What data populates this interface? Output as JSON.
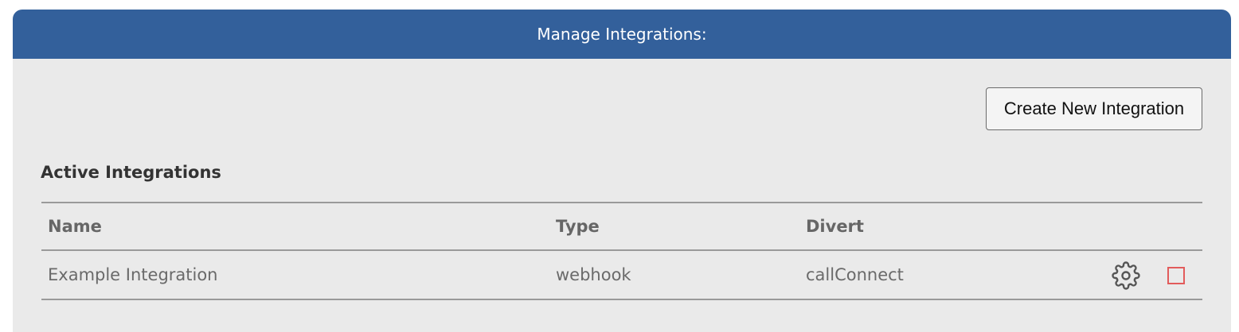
{
  "header": {
    "title": "Manage Integrations:"
  },
  "toolbar": {
    "create_label": "Create New Integration"
  },
  "section": {
    "title": "Active Integrations"
  },
  "table": {
    "columns": [
      "Name",
      "Type",
      "Divert"
    ],
    "rows": [
      {
        "name": "Example Integration",
        "type": "webhook",
        "divert": "callConnect",
        "actions": [
          "gear-icon",
          "delete-icon"
        ]
      }
    ]
  },
  "colors": {
    "header_bg": "#33609b",
    "panel_bg": "#eaeaea",
    "delete_accent": "#e25b5b"
  }
}
